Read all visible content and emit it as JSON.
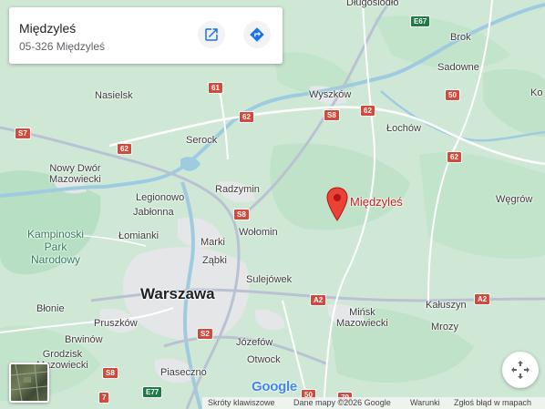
{
  "place_card": {
    "title": "Międzyleś",
    "address": "05-326 Międzyleś"
  },
  "pin": {
    "label": "Międzyleś"
  },
  "places": {
    "dlugosiodlo": "Długosiodło",
    "brok": "Brok",
    "sadowne": "Sadowne",
    "nasielsk": "Nasielsk",
    "wyszkow": "Wyszków",
    "lochow": "Łochów",
    "serock": "Serock",
    "nowy_dwor": "Nowy Dwór\nMazowiecki",
    "legionowo": "Legionowo",
    "radzymin": "Radzymin",
    "jablonna": "Jabłonna",
    "wegrow": "Węgrów",
    "lomianki": "Łomianki",
    "wolomin": "Wołomin",
    "kampinoski": "Kampinoski\nPark\nNarodowy",
    "marki": "Marki",
    "zabki": "Ząbki",
    "sulejowek": "Sulejówek",
    "warszawa": "Warszawa",
    "blonie": "Błonie",
    "minsk": "Mińsk\nMazowiecki",
    "kaluszyn": "Kałuszyn",
    "pruszkow": "Pruszków",
    "mrozy": "Mrozy",
    "brwinow": "Brwinów",
    "jozefow": "Józefów",
    "grodzisk": "Grodzisk\nMazowiecki",
    "otwock": "Otwock",
    "piaseczno": "Piaseczno",
    "ko": "Ko"
  },
  "shields": {
    "e67": "E67",
    "r61": "61",
    "r62a": "62",
    "r62b": "62",
    "r62c": "62",
    "r62d": "62",
    "r50a": "50",
    "r50b": "50",
    "s8a": "S8",
    "s8b": "S8",
    "s8c": "S8",
    "s7": "S7",
    "s2": "S2",
    "a2a": "A2",
    "a2b": "A2",
    "e77": "E77",
    "r7": "7",
    "r79": "79"
  },
  "google_logo": "Google",
  "footer": {
    "shortcuts": "Skróty klawiszowe",
    "map_data": "Dane mapy ©2026 Google",
    "terms": "Warunki",
    "report": "Zgłoś błąd w mapach"
  },
  "colors": {
    "land": "#cfe8d6",
    "forest": "#b7dfc3",
    "urban": "#e4e6e8",
    "water": "#9fcbe0",
    "road": "#ffffff",
    "motorway": "#b9c2d3",
    "pin": "#ea4335",
    "accent": "#1a73e8"
  },
  "icons": {
    "open": "open-in-new-icon",
    "directions": "directions-icon",
    "fullscreen": "fullscreen-icon"
  }
}
